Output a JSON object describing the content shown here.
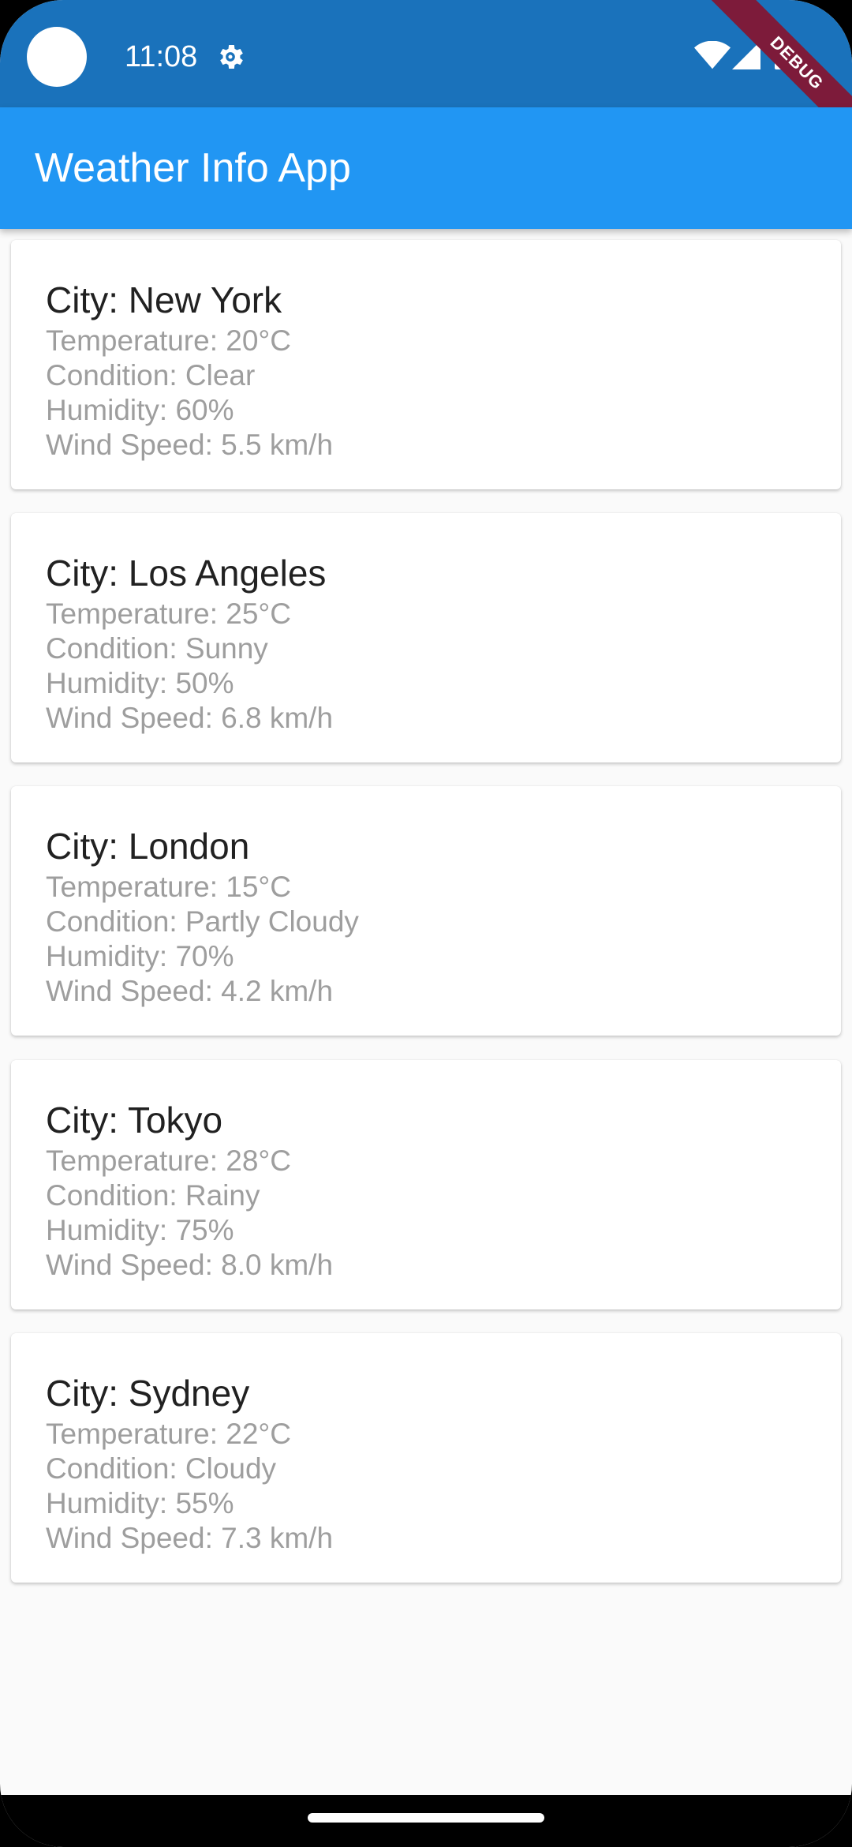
{
  "status_bar": {
    "time": "11:08",
    "icons": [
      "settings-icon",
      "wifi-icon",
      "signal-icon",
      "battery-icon"
    ],
    "background": "#1a72bb"
  },
  "debug_banner": "DEBUG",
  "app_bar": {
    "title": "Weather Info App",
    "background": "#2196f3"
  },
  "cities": [
    {
      "city": "City: New York",
      "temperature": "Temperature: 20°C",
      "condition": "Condition: Clear",
      "humidity": "Humidity: 60%",
      "wind": "Wind Speed: 5.5 km/h"
    },
    {
      "city": "City: Los Angeles",
      "temperature": "Temperature: 25°C",
      "condition": "Condition: Sunny",
      "humidity": "Humidity: 50%",
      "wind": "Wind Speed: 6.8 km/h"
    },
    {
      "city": "City: London",
      "temperature": "Temperature: 15°C",
      "condition": "Condition: Partly Cloudy",
      "humidity": "Humidity: 70%",
      "wind": "Wind Speed: 4.2 km/h"
    },
    {
      "city": "City: Tokyo",
      "temperature": "Temperature: 28°C",
      "condition": "Condition: Rainy",
      "humidity": "Humidity: 75%",
      "wind": "Wind Speed: 8.0 km/h"
    },
    {
      "city": "City: Sydney",
      "temperature": "Temperature: 22°C",
      "condition": "Condition: Cloudy",
      "humidity": "Humidity: 55%",
      "wind": "Wind Speed: 7.3 km/h"
    }
  ]
}
